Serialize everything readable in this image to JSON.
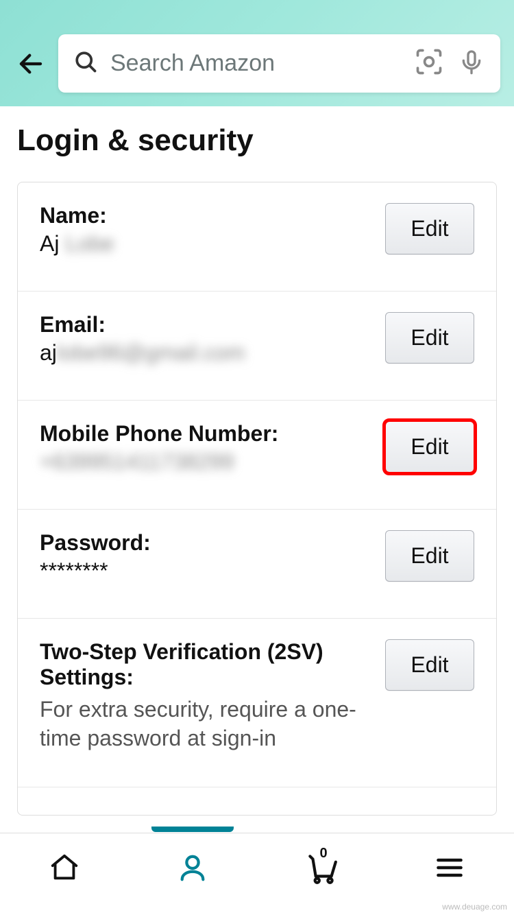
{
  "header": {
    "search_placeholder": "Search Amazon"
  },
  "page": {
    "title": "Login & security"
  },
  "rows": {
    "name": {
      "label": "Name:",
      "value_visible": "Aj",
      "value_hidden": " Lobe",
      "edit": "Edit"
    },
    "email": {
      "label": "Email:",
      "value_visible": "aj",
      "value_hidden": "lobe96@gmail.com",
      "edit": "Edit"
    },
    "phone": {
      "label": "Mobile Phone Number:",
      "value_hidden": "+639951411738299",
      "edit": "Edit"
    },
    "password": {
      "label": "Password:",
      "value": "********",
      "edit": "Edit"
    },
    "twostep": {
      "label": "Two-Step Verification (2SV) Settings:",
      "desc": "For extra security, require a one-time password at sign-in",
      "edit": "Edit"
    }
  },
  "nav": {
    "cart_count": "0"
  },
  "watermark": "www.deuage.com"
}
